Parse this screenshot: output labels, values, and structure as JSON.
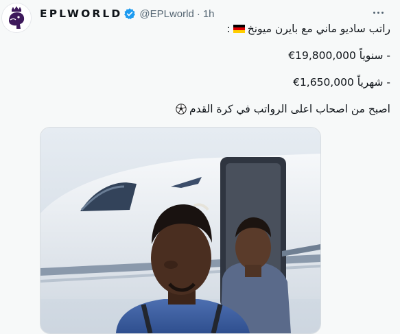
{
  "tweet": {
    "author": {
      "display_name": "EPLWORLD",
      "handle": "@EPLworld",
      "verified": true,
      "avatar_icon": "premier-league-lion-icon"
    },
    "separator": "·",
    "timestamp": "1h",
    "more_icon": "more-dots-icon",
    "text": {
      "line1": "راتب ساديو ماني مع بايرن ميونخ",
      "line1_suffix": ":",
      "line2": "- سنوياً 19,800,000€",
      "line3": "- شهرياً 1,650,000€",
      "line4": "اصبح من اصحاب اعلى الرواتب في كرة القدم",
      "flag_icon": "germany-flag-icon",
      "ball_icon": "soccer-ball-icon"
    },
    "media": {
      "type": "photo",
      "icon": "photo-two-men-by-private-jet"
    }
  },
  "colors": {
    "background": "#f7f9f9",
    "text": "#0f1419",
    "secondary_text": "#536471",
    "verified_blue": "#1d9bf0",
    "premier_league_purple": "#3d195b"
  }
}
